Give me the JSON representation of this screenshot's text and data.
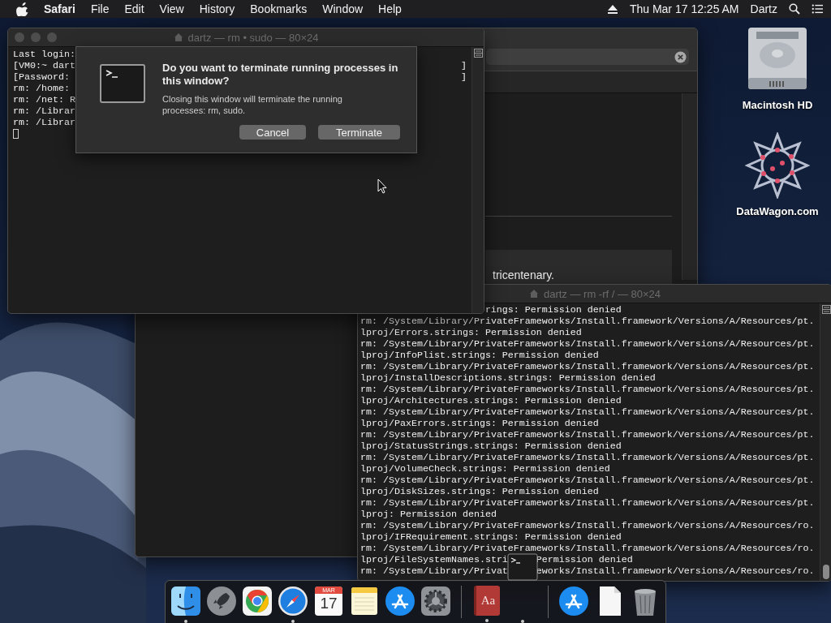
{
  "menu_bar": {
    "app": "Safari",
    "menus": [
      "File",
      "Edit",
      "View",
      "History",
      "Bookmarks",
      "Window",
      "Help"
    ],
    "clock": "Thu Mar 17  12:25 AM",
    "user": "Dartz"
  },
  "desktop_icons": [
    {
      "kind": "disk",
      "label": "Macintosh HD"
    },
    {
      "kind": "web",
      "label": "DataWagon.com"
    }
  ],
  "browser_window": {
    "excerpt": "tricentenary."
  },
  "terminal_front": {
    "title": "dartz — rm • sudo — 80×24",
    "lines": [
      {
        "text": "Last login:"
      },
      {
        "text": "[VM0:~ dart",
        "end": "]"
      },
      {
        "text": "[Password:",
        "end": "]"
      },
      {
        "text": "rm: /home:"
      },
      {
        "text": "rm: /net: R"
      },
      {
        "text": "rm: /Librar"
      },
      {
        "text": "rm: /Librar"
      }
    ],
    "sheet": {
      "title": "Do you want to terminate running processes in this window?",
      "message": "Closing this window will terminate the running processes: rm, sudo.",
      "buttons": [
        "Cancel",
        "Terminate"
      ]
    }
  },
  "terminal_back": {
    "title": "dartz — rm -rf / — 80×24",
    "lines": [
      {
        "kind": "clipped",
        "parts": [
          "rings: Permission denied"
        ]
      },
      {
        "kind": "full",
        "parts": [
          "rm: /System/Library/PrivateFrameworks/Install.framework/Versions/A/Resources/pt."
        ]
      },
      {
        "kind": "full",
        "parts": [
          "lproj/Errors.strings: Permission denied"
        ]
      },
      {
        "kind": "full",
        "parts": [
          "rm: /System/Library/PrivateFrameworks/Install.framework/Versions/A/Resources/pt."
        ]
      },
      {
        "kind": "full",
        "parts": [
          "lproj/InfoPlist.strings: Permission denied"
        ]
      },
      {
        "kind": "full",
        "parts": [
          "rm: /System/Library/PrivateFrameworks/Install.framework/Versions/A/Resources/pt."
        ]
      },
      {
        "kind": "full",
        "parts": [
          "lproj/InstallDescriptions.strings: Permission denied"
        ]
      },
      {
        "kind": "full",
        "parts": [
          "rm: /System/Library/PrivateFrameworks/Install.framework/Versions/A/Resources/pt."
        ]
      },
      {
        "kind": "full",
        "parts": [
          "lproj/Architectures.strings: Permission denied"
        ]
      },
      {
        "kind": "full",
        "parts": [
          "rm: /System/Library/PrivateFrameworks/Install.framework/Versions/A/Resources/pt."
        ]
      },
      {
        "kind": "full",
        "parts": [
          "lproj/PaxErrors.strings: Permission denied"
        ]
      },
      {
        "kind": "full",
        "parts": [
          "rm: /System/Library/PrivateFrameworks/Install.framework/Versions/A/Resources/pt."
        ]
      },
      {
        "kind": "full",
        "parts": [
          "lproj/StatusStrings.strings: Permission denied"
        ]
      },
      {
        "kind": "full",
        "parts": [
          "rm: /System/Library/PrivateFrameworks/Install.framework/Versions/A/Resources/pt."
        ]
      },
      {
        "kind": "full",
        "parts": [
          "lproj/VolumeCheck.strings: Permission denied"
        ]
      },
      {
        "kind": "full",
        "parts": [
          "rm: /System/Library/PrivateFrameworks/Install.framework/Versions/A/Resources/pt."
        ]
      },
      {
        "kind": "full",
        "parts": [
          "lproj/DiskSizes.strings: Permission denied"
        ]
      },
      {
        "kind": "full",
        "parts": [
          "rm: /System/Library/PrivateFrameworks/Install.framework/Versions/A/Resources/pt."
        ]
      },
      {
        "kind": "full",
        "parts": [
          "lproj: Permission denied"
        ]
      },
      {
        "kind": "full",
        "parts": [
          "rm: /System/Library/PrivateFrameworks/Install.framework/Versions/A/Resources/ro."
        ]
      },
      {
        "kind": "full",
        "parts": [
          "lproj/IFRequirement.strings: Permission denied"
        ]
      },
      {
        "kind": "full",
        "parts": [
          "rm: /System/Library/PrivateFrameworks/Install.framework/Versions/A/Resources/ro."
        ]
      },
      {
        "kind": "full",
        "parts": [
          "lproj/FileSystemNames.stri",
          "Permission denied"
        ]
      },
      {
        "kind": "full",
        "parts": [
          "rm: /System/Library/Privat",
          "eworks/Install.framework/Versions/A/Resources/ro."
        ]
      }
    ]
  },
  "dock": [
    {
      "kind": "finder",
      "running": true
    },
    {
      "kind": "launchpad",
      "running": false
    },
    {
      "kind": "chrome",
      "running": false
    },
    {
      "kind": "safari",
      "running": true
    },
    {
      "kind": "calendar",
      "month": "MAR",
      "day": "17",
      "running": false
    },
    {
      "kind": "notes",
      "running": false
    },
    {
      "kind": "appstore",
      "running": false
    },
    {
      "kind": "preferences",
      "running": false
    },
    {
      "kind": "separator"
    },
    {
      "kind": "dictionary",
      "label": "Aa",
      "running": true
    },
    {
      "kind": "terminal",
      "running": true
    },
    {
      "kind": "separator"
    },
    {
      "kind": "appstore",
      "running": false
    },
    {
      "kind": "document",
      "running": false
    },
    {
      "kind": "trash",
      "running": false
    }
  ]
}
